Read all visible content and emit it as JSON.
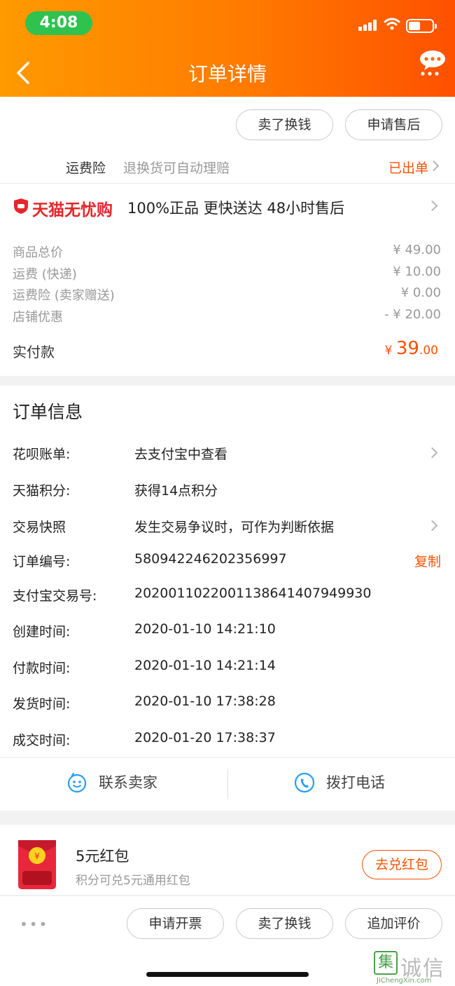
{
  "status_bar": {
    "time": "4:08"
  },
  "header": {
    "title": "订单详情"
  },
  "top_actions": {
    "sell_label": "卖了换钱",
    "after_sale_label": "申请售后"
  },
  "insurance": {
    "label": "运费险",
    "desc": "退换货可自动理赔",
    "status": "已出单"
  },
  "tmall": {
    "brand": "天猫无忧购",
    "promise": "100%正品  更快送达  48小时售后"
  },
  "price": {
    "rows": [
      {
        "label": "商品总价",
        "value": "¥ 49.00"
      },
      {
        "label": "运费 (快递)",
        "value": "¥ 10.00"
      },
      {
        "label": "运费险 (卖家赠送)",
        "value": "¥ 0.00"
      },
      {
        "label": "店铺优惠",
        "value": "- ¥ 20.00"
      }
    ],
    "paid_label": "实付款",
    "paid_currency": "¥ ",
    "paid_main": "39",
    "paid_decimal": ".00"
  },
  "order_info": {
    "title": "订单信息",
    "rows": [
      {
        "label": "花呗账单:",
        "value": "去支付宝中查看"
      },
      {
        "label": "天猫积分:",
        "value": "获得14点积分"
      },
      {
        "label": "交易快照",
        "value": "发生交易争议时，可作为判断依据"
      },
      {
        "label": "订单编号:",
        "value": "580942246202356997"
      },
      {
        "label": "支付宝交易号:",
        "value": "2020011022001138641407949930"
      },
      {
        "label": "创建时间:",
        "value": "2020-01-10 14:21:10"
      },
      {
        "label": "付款时间:",
        "value": "2020-01-10 14:21:14"
      },
      {
        "label": "发货时间:",
        "value": "2020-01-10 17:38:28"
      },
      {
        "label": "成交时间:",
        "value": "2020-01-20 17:38:37"
      }
    ],
    "copy_label": "复制"
  },
  "contact": {
    "seller_label": "联系卖家",
    "call_label": "拨打电话"
  },
  "hongbao": {
    "title": "5元红包",
    "subtitle": "积分可兑5元通用红包",
    "button": "去兑红包"
  },
  "bottom_bar": {
    "more": "•••",
    "invoice_label": "申请开票",
    "sell_label": "卖了换钱",
    "review_label": "追加评价"
  },
  "watermark": {
    "chars": "诚信",
    "domain": "JiChengXin.com",
    "logo_char": "集"
  },
  "colors": {
    "accent": "#ff5000",
    "header_start": "#ff9a00",
    "header_end": "#ff5000",
    "tmall_red": "#e5262b"
  }
}
